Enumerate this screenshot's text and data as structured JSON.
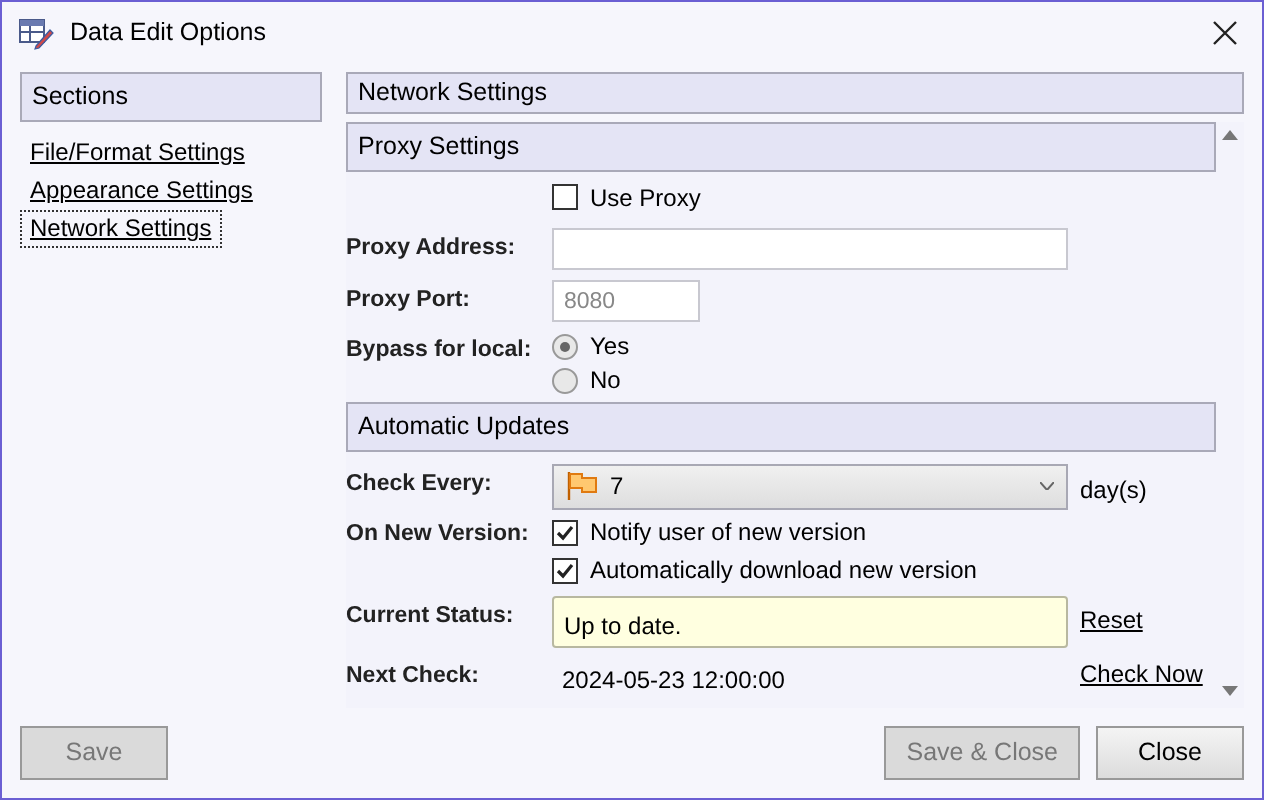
{
  "window": {
    "title": "Data Edit Options"
  },
  "sidebar": {
    "header": "Sections",
    "items": [
      {
        "label": "File/Format Settings",
        "selected": false
      },
      {
        "label": "Appearance Settings",
        "selected": false
      },
      {
        "label": "Network Settings",
        "selected": true
      }
    ]
  },
  "panel": {
    "header": "Network Settings",
    "proxy": {
      "title": "Proxy Settings",
      "use_proxy": {
        "label": "Use Proxy",
        "checked": false
      },
      "address": {
        "label": "Proxy Address:",
        "disabled": true
      },
      "port": {
        "label": "Proxy Port:",
        "value": "8080",
        "disabled": true
      },
      "bypass": {
        "label": "Bypass for local:",
        "options": [
          {
            "label": "Yes",
            "selected": true
          },
          {
            "label": "No",
            "selected": false
          }
        ]
      }
    },
    "updates": {
      "title": "Automatic Updates",
      "check_every": {
        "label": "Check Every:",
        "value": "7",
        "unit": "day(s)"
      },
      "on_new_version": {
        "label": "On New Version:",
        "options": [
          {
            "label": "Notify user of new version",
            "checked": true
          },
          {
            "label": "Automatically download new version",
            "checked": true
          }
        ]
      },
      "current_status": {
        "label": "Current Status:",
        "value": "Up to date.",
        "link": "Reset"
      },
      "next_check": {
        "label": "Next Check:",
        "value": "2024-05-23 12:00:00",
        "link": "Check Now"
      }
    }
  },
  "footer": {
    "left": [
      {
        "label": "Save",
        "disabled": true
      }
    ],
    "right": [
      {
        "label": "Save & Close",
        "disabled": true
      },
      {
        "label": "Close",
        "disabled": false
      }
    ]
  }
}
